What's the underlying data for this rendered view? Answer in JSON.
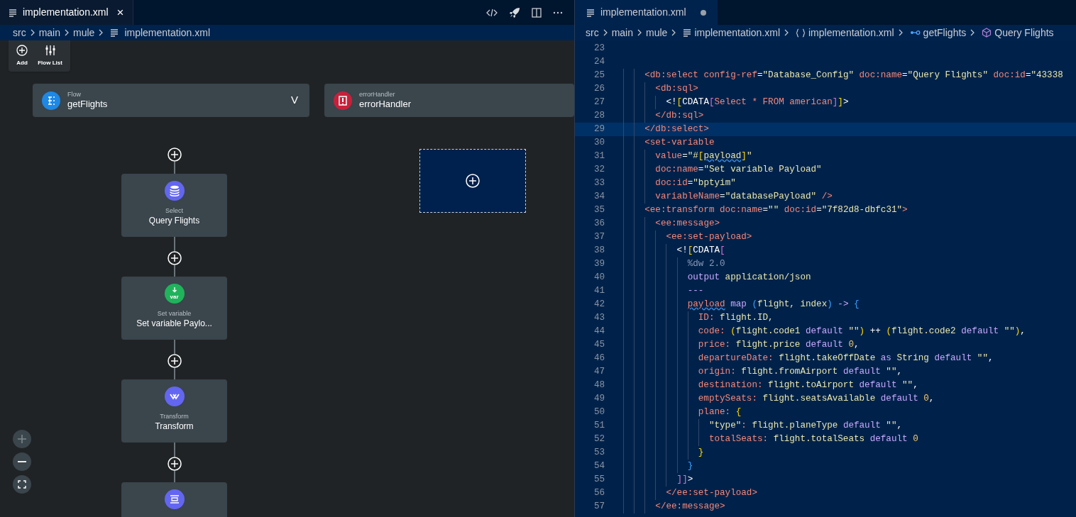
{
  "left_editor": {
    "tab": {
      "title": "implementation.xml",
      "close": "×"
    },
    "breadcrumbs": [
      "src",
      "main",
      "mule",
      "implementation.xml"
    ],
    "toolbar": [
      {
        "kind": "add",
        "label": "Add"
      },
      {
        "kind": "flowlist",
        "label": "Flow List"
      }
    ],
    "flows": [
      {
        "kind": "flow",
        "type": "Flow",
        "name": "getFlights",
        "chevron": "V"
      },
      {
        "kind": "error",
        "type": "errorHandler",
        "name": "errorHandler"
      }
    ],
    "nodes": [
      {
        "kind": "database",
        "type": "Select",
        "name": "Query Flights"
      },
      {
        "kind": "variable",
        "type": "Set variable",
        "name": "Set variable Paylo...",
        "icon_text": "var"
      },
      {
        "kind": "transform",
        "type": "Transform",
        "name": "Transform"
      },
      {
        "kind": "logger"
      }
    ]
  },
  "right_editor": {
    "tab": {
      "title": "implementation.xml",
      "modified": true
    },
    "breadcrumbs": [
      {
        "kind": "folder",
        "label": "src"
      },
      {
        "kind": "folder",
        "label": "main"
      },
      {
        "kind": "folder",
        "label": "mule"
      },
      {
        "kind": "file",
        "label": "implementation.xml"
      },
      {
        "kind": "braces",
        "label": "implementation.xml"
      },
      {
        "kind": "flow",
        "label": "getFlights"
      },
      {
        "kind": "cube",
        "label": "Query Flights"
      }
    ],
    "lines": [
      {
        "number": "23",
        "current": false
      },
      {
        "number": "24",
        "current": false
      },
      {
        "number": "25",
        "current": false,
        "tokens": [
          {
            "kind": "tag",
            "text": "    <db:select "
          },
          {
            "kind": "tag",
            "text": "config-ref"
          },
          {
            "kind": "plain",
            "text": "="
          },
          {
            "kind": "str",
            "text": "\"Database_Config\" "
          },
          {
            "kind": "tag",
            "text": "doc:name"
          },
          {
            "kind": "plain",
            "text": "="
          },
          {
            "kind": "str",
            "text": "\"Query Flights\" "
          },
          {
            "kind": "tag",
            "text": "doc:id"
          },
          {
            "kind": "plain",
            "text": "="
          },
          {
            "kind": "str",
            "text": "\"43338"
          }
        ]
      },
      {
        "number": "26",
        "current": false,
        "tokens": [
          {
            "kind": "tag",
            "text": "      <db:sql>"
          }
        ]
      },
      {
        "number": "27",
        "current": false,
        "tokens": [
          {
            "kind": "plain",
            "text": "        <!"
          },
          {
            "kind": "b1",
            "text": "["
          },
          {
            "kind": "plain",
            "text": "CDATA"
          },
          {
            "kind": "b2",
            "text": "["
          },
          {
            "kind": "tag",
            "text": "Select * FROM american"
          },
          {
            "kind": "b2",
            "text": "]"
          },
          {
            "kind": "b1",
            "text": "]"
          },
          {
            "kind": "plain",
            "text": ">"
          }
        ]
      },
      {
        "number": "28",
        "current": false,
        "tokens": [
          {
            "kind": "tag",
            "text": "      </db:sql>"
          }
        ]
      },
      {
        "number": "29",
        "current": true,
        "tokens": [
          {
            "kind": "tag",
            "text": "    </db:select>"
          }
        ]
      },
      {
        "number": "30",
        "current": false,
        "tokens": [
          {
            "kind": "tag",
            "text": "    <set-variable"
          }
        ]
      },
      {
        "number": "31",
        "current": false,
        "tokens": [
          {
            "kind": "tag",
            "text": "      value"
          },
          {
            "kind": "plain",
            "text": "="
          },
          {
            "kind": "str",
            "text": "\"#"
          },
          {
            "kind": "b1",
            "text": "["
          },
          {
            "kind": "str-warn",
            "text": "payload"
          },
          {
            "kind": "b1",
            "text": "]"
          },
          {
            "kind": "str",
            "text": "\""
          }
        ]
      },
      {
        "number": "32",
        "current": false,
        "tokens": [
          {
            "kind": "tag",
            "text": "      doc:name"
          },
          {
            "kind": "plain",
            "text": "="
          },
          {
            "kind": "str",
            "text": "\"Set variable Payload\""
          }
        ]
      },
      {
        "number": "33",
        "current": false,
        "tokens": [
          {
            "kind": "tag",
            "text": "      doc:id"
          },
          {
            "kind": "plain",
            "text": "="
          },
          {
            "kind": "str",
            "text": "\"bptyim\""
          }
        ]
      },
      {
        "number": "34",
        "current": false,
        "tokens": [
          {
            "kind": "tag",
            "text": "      variableName"
          },
          {
            "kind": "plain",
            "text": "="
          },
          {
            "kind": "str",
            "text": "\"databasePayload\" "
          },
          {
            "kind": "tag",
            "text": "/>"
          }
        ]
      },
      {
        "number": "35",
        "current": false,
        "tokens": [
          {
            "kind": "tag",
            "text": "    <ee:transform "
          },
          {
            "kind": "tag",
            "text": "doc:name"
          },
          {
            "kind": "plain",
            "text": "="
          },
          {
            "kind": "str",
            "text": "\"\" "
          },
          {
            "kind": "tag",
            "text": "doc:id"
          },
          {
            "kind": "plain",
            "text": "="
          },
          {
            "kind": "str",
            "text": "\"7f82d8-dbfc31\""
          },
          {
            "kind": "tag",
            "text": ">"
          }
        ]
      },
      {
        "number": "36",
        "current": false,
        "tokens": [
          {
            "kind": "tag",
            "text": "      <ee:message>"
          }
        ]
      },
      {
        "number": "37",
        "current": false,
        "tokens": [
          {
            "kind": "tag",
            "text": "        <ee:set-payload>"
          }
        ]
      },
      {
        "number": "38",
        "current": false,
        "tokens": [
          {
            "kind": "plain",
            "text": "          <!"
          },
          {
            "kind": "b1",
            "text": "["
          },
          {
            "kind": "plain",
            "text": "CDATA"
          },
          {
            "kind": "b2",
            "text": "["
          }
        ]
      },
      {
        "number": "39",
        "current": false,
        "tokens": [
          {
            "kind": "comment",
            "text": "            %dw 2.0"
          }
        ]
      },
      {
        "number": "40",
        "current": false,
        "tokens": [
          {
            "kind": "kw",
            "text": "            output "
          },
          {
            "kind": "str",
            "text": "application/json"
          }
        ]
      },
      {
        "number": "41",
        "current": false,
        "tokens": [
          {
            "kind": "kw",
            "text": "            ---"
          }
        ]
      },
      {
        "number": "42",
        "current": false,
        "tokens": [
          {
            "kind": "tag-warn",
            "text": "            payload"
          },
          {
            "kind": "kw",
            "text": " map "
          },
          {
            "kind": "b3",
            "text": "("
          },
          {
            "kind": "str",
            "text": "flight, index"
          },
          {
            "kind": "b3",
            "text": ")"
          },
          {
            "kind": "kw",
            "text": " -> "
          },
          {
            "kind": "b3",
            "text": "{"
          }
        ]
      },
      {
        "number": "43",
        "current": false,
        "tokens": [
          {
            "kind": "tag",
            "text": "              ID: "
          },
          {
            "kind": "str",
            "text": "flight.ID,"
          }
        ]
      },
      {
        "number": "44",
        "current": false,
        "tokens": [
          {
            "kind": "tag",
            "text": "              code: "
          },
          {
            "kind": "b1",
            "text": "("
          },
          {
            "kind": "str",
            "text": "flight.code1 "
          },
          {
            "kind": "kw",
            "text": "default "
          },
          {
            "kind": "str",
            "text": "\"\""
          },
          {
            "kind": "b1",
            "text": ")"
          },
          {
            "kind": "plain",
            "text": " ++ "
          },
          {
            "kind": "b1",
            "text": "("
          },
          {
            "kind": "str",
            "text": "flight.code2 "
          },
          {
            "kind": "kw",
            "text": "default "
          },
          {
            "kind": "str",
            "text": "\"\""
          },
          {
            "kind": "b1",
            "text": ")"
          },
          {
            "kind": "plain",
            "text": ","
          }
        ]
      },
      {
        "number": "45",
        "current": false,
        "tokens": [
          {
            "kind": "tag",
            "text": "              price: "
          },
          {
            "kind": "str",
            "text": "flight.price "
          },
          {
            "kind": "kw",
            "text": "default "
          },
          {
            "kind": "num",
            "text": "0"
          },
          {
            "kind": "plain",
            "text": ","
          }
        ]
      },
      {
        "number": "46",
        "current": false,
        "tokens": [
          {
            "kind": "tag",
            "text": "              departureDate: "
          },
          {
            "kind": "str",
            "text": "flight.takeOffDate "
          },
          {
            "kind": "kw",
            "text": "as "
          },
          {
            "kind": "str",
            "text": "String "
          },
          {
            "kind": "kw",
            "text": "default "
          },
          {
            "kind": "str",
            "text": "\"\""
          },
          {
            "kind": "plain",
            "text": ","
          }
        ]
      },
      {
        "number": "47",
        "current": false,
        "tokens": [
          {
            "kind": "tag",
            "text": "              origin: "
          },
          {
            "kind": "str",
            "text": "flight.fromAirport "
          },
          {
            "kind": "kw",
            "text": "default "
          },
          {
            "kind": "str",
            "text": "\"\""
          },
          {
            "kind": "plain",
            "text": ","
          }
        ]
      },
      {
        "number": "48",
        "current": false,
        "tokens": [
          {
            "kind": "tag",
            "text": "              destination: "
          },
          {
            "kind": "str",
            "text": "flight.toAirport "
          },
          {
            "kind": "kw",
            "text": "default "
          },
          {
            "kind": "str",
            "text": "\"\""
          },
          {
            "kind": "plain",
            "text": ","
          }
        ]
      },
      {
        "number": "49",
        "current": false,
        "tokens": [
          {
            "kind": "tag",
            "text": "              emptySeats: "
          },
          {
            "kind": "str",
            "text": "flight.seatsAvailable "
          },
          {
            "kind": "kw",
            "text": "default "
          },
          {
            "kind": "num",
            "text": "0"
          },
          {
            "kind": "plain",
            "text": ","
          }
        ]
      },
      {
        "number": "50",
        "current": false,
        "tokens": [
          {
            "kind": "tag",
            "text": "              plane: "
          },
          {
            "kind": "b1",
            "text": "{"
          }
        ]
      },
      {
        "number": "51",
        "current": false,
        "tokens": [
          {
            "kind": "str",
            "text": "                \"type\""
          },
          {
            "kind": "tag",
            "text": ": "
          },
          {
            "kind": "str",
            "text": "flight.planeType "
          },
          {
            "kind": "kw",
            "text": "default "
          },
          {
            "kind": "str",
            "text": "\"\""
          },
          {
            "kind": "plain",
            "text": ","
          }
        ]
      },
      {
        "number": "52",
        "current": false,
        "tokens": [
          {
            "kind": "tag",
            "text": "                totalSeats: "
          },
          {
            "kind": "str",
            "text": "flight.totalSeats "
          },
          {
            "kind": "kw",
            "text": "default "
          },
          {
            "kind": "num",
            "text": "0"
          }
        ]
      },
      {
        "number": "53",
        "current": false,
        "tokens": [
          {
            "kind": "b1",
            "text": "              }"
          }
        ]
      },
      {
        "number": "54",
        "current": false,
        "tokens": [
          {
            "kind": "b3",
            "text": "            }"
          }
        ]
      },
      {
        "number": "55",
        "current": false,
        "tokens": [
          {
            "kind": "b2",
            "text": "          ]]"
          },
          {
            "kind": "plain",
            "text": ">"
          }
        ]
      },
      {
        "number": "56",
        "current": false,
        "tokens": [
          {
            "kind": "tag",
            "text": "        </ee:set-payload>"
          }
        ]
      },
      {
        "number": "57",
        "current": false,
        "tokens": [
          {
            "kind": "tag",
            "text": "      </ee:message>"
          }
        ]
      }
    ]
  }
}
